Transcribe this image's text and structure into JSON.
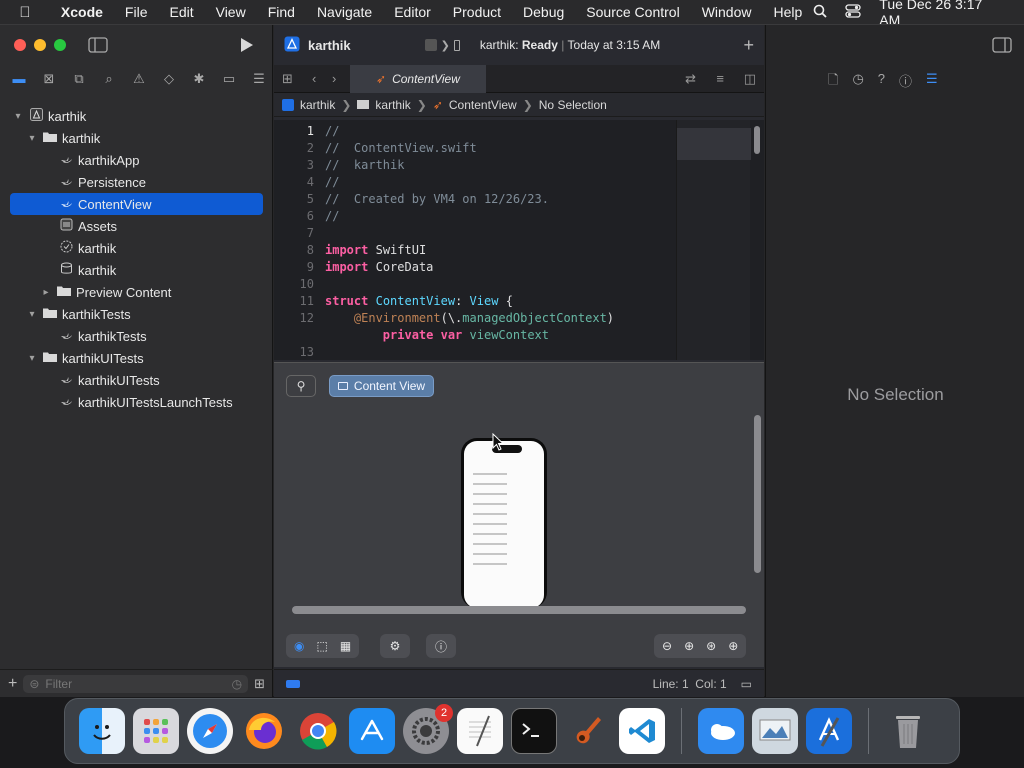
{
  "menubar": {
    "apple": "",
    "app": "Xcode",
    "items": [
      "File",
      "Edit",
      "View",
      "Find",
      "Navigate",
      "Editor",
      "Product",
      "Debug",
      "Source Control",
      "Window",
      "Help"
    ],
    "clock": "Tue Dec 26  3:17 AM"
  },
  "toolbar": {
    "project": "karthik",
    "status_target": "karthik:",
    "status_state": "Ready",
    "status_time": "Today at 3:15 AM",
    "add": "+"
  },
  "tab": {
    "label": "ContentView"
  },
  "jumpbar": {
    "crumbs": [
      "karthik",
      "karthik",
      "ContentView",
      "No Selection"
    ]
  },
  "navigator": {
    "tree": [
      {
        "label": "karthik"
      },
      {
        "label": "karthik"
      },
      {
        "label": "karthikApp"
      },
      {
        "label": "Persistence"
      },
      {
        "label": "ContentView"
      },
      {
        "label": "Assets"
      },
      {
        "label": "karthik"
      },
      {
        "label": "karthik"
      },
      {
        "label": "Preview Content"
      },
      {
        "label": "karthikTests"
      },
      {
        "label": "karthikTests"
      },
      {
        "label": "karthikUITests"
      },
      {
        "label": "karthikUITests"
      },
      {
        "label": "karthikUITestsLaunchTests"
      }
    ],
    "filter_placeholder": "Filter"
  },
  "code": {
    "line_numbers": [
      "1",
      "2",
      "3",
      "4",
      "5",
      "6",
      "7",
      "8",
      "9",
      "10",
      "11",
      "12",
      "",
      "13"
    ],
    "c1": "//",
    "c2": "//  ContentView.swift",
    "c3": "//  karthik",
    "c4": "//",
    "c5": "//  Created by VM4 on 12/26/23.",
    "c6": "//",
    "import_kw": "import",
    "mod1": "SwiftUI",
    "mod2": "CoreData",
    "struct_kw": "struct",
    "struct_name": "ContentView",
    "colon": ":",
    "view_type": "View",
    "brace": "{",
    "attr": "@Environment",
    "keypath": "(\\.",
    "keypath_name": "managedObjectContext",
    "close_paren": ")",
    "private_kw": "private",
    "var_kw": "var",
    "var_name": "viewContext"
  },
  "preview": {
    "pin": "⚲",
    "button": "Content View"
  },
  "status": {
    "position": "Line: 1  Col: 1"
  },
  "inspector": {
    "empty": "No Selection"
  },
  "dock": {
    "settings_badge": "2"
  }
}
